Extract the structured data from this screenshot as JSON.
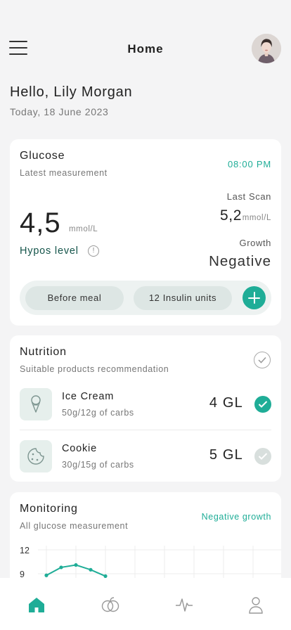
{
  "header": {
    "title": "Home"
  },
  "greeting": {
    "hello": "Hello, Lily Morgan",
    "date": "Today, 18 June 2023"
  },
  "glucose": {
    "title": "Glucose",
    "subtitle": "Latest measurement",
    "time": "08:00 PM",
    "value": "4,5",
    "unit": "mmol/L",
    "hypos_label": "Hypos level",
    "last_scan_label": "Last Scan",
    "last_scan_value": "5,2",
    "last_scan_unit": "mmol/L",
    "growth_label": "Growth",
    "growth_value": "Negative",
    "meal_pill": "Before meal",
    "insulin_pill": "12 Insulin units"
  },
  "nutrition": {
    "title": "Nutrition",
    "subtitle": "Suitable products recommendation",
    "items": [
      {
        "name": "Ice Cream",
        "carbs": "50g/12g of carbs",
        "gl": "4 GL",
        "checked": true
      },
      {
        "name": "Cookie",
        "carbs": "30g/15g of carbs",
        "gl": "5 GL",
        "checked": false
      }
    ]
  },
  "monitoring": {
    "title": "Monitoring",
    "subtitle": "All glucose measurement",
    "growth": "Negative growth",
    "y_ticks": [
      "12",
      "9"
    ]
  },
  "chart_data": {
    "type": "line",
    "y_ticks_visible": [
      9,
      12
    ],
    "series": [
      {
        "values": [
          8.8,
          9.8,
          10.1,
          9.5,
          8.7
        ]
      }
    ],
    "grid": true
  },
  "tabs": [
    {
      "icon": "home-icon",
      "active": true
    },
    {
      "icon": "nutrition-icon",
      "active": false
    },
    {
      "icon": "pulse-icon",
      "active": false
    },
    {
      "icon": "profile-icon",
      "active": false
    }
  ],
  "colors": {
    "accent": "#1fad97",
    "background": "#f4f4f5",
    "card": "#ffffff",
    "hypos": "#14544a"
  }
}
